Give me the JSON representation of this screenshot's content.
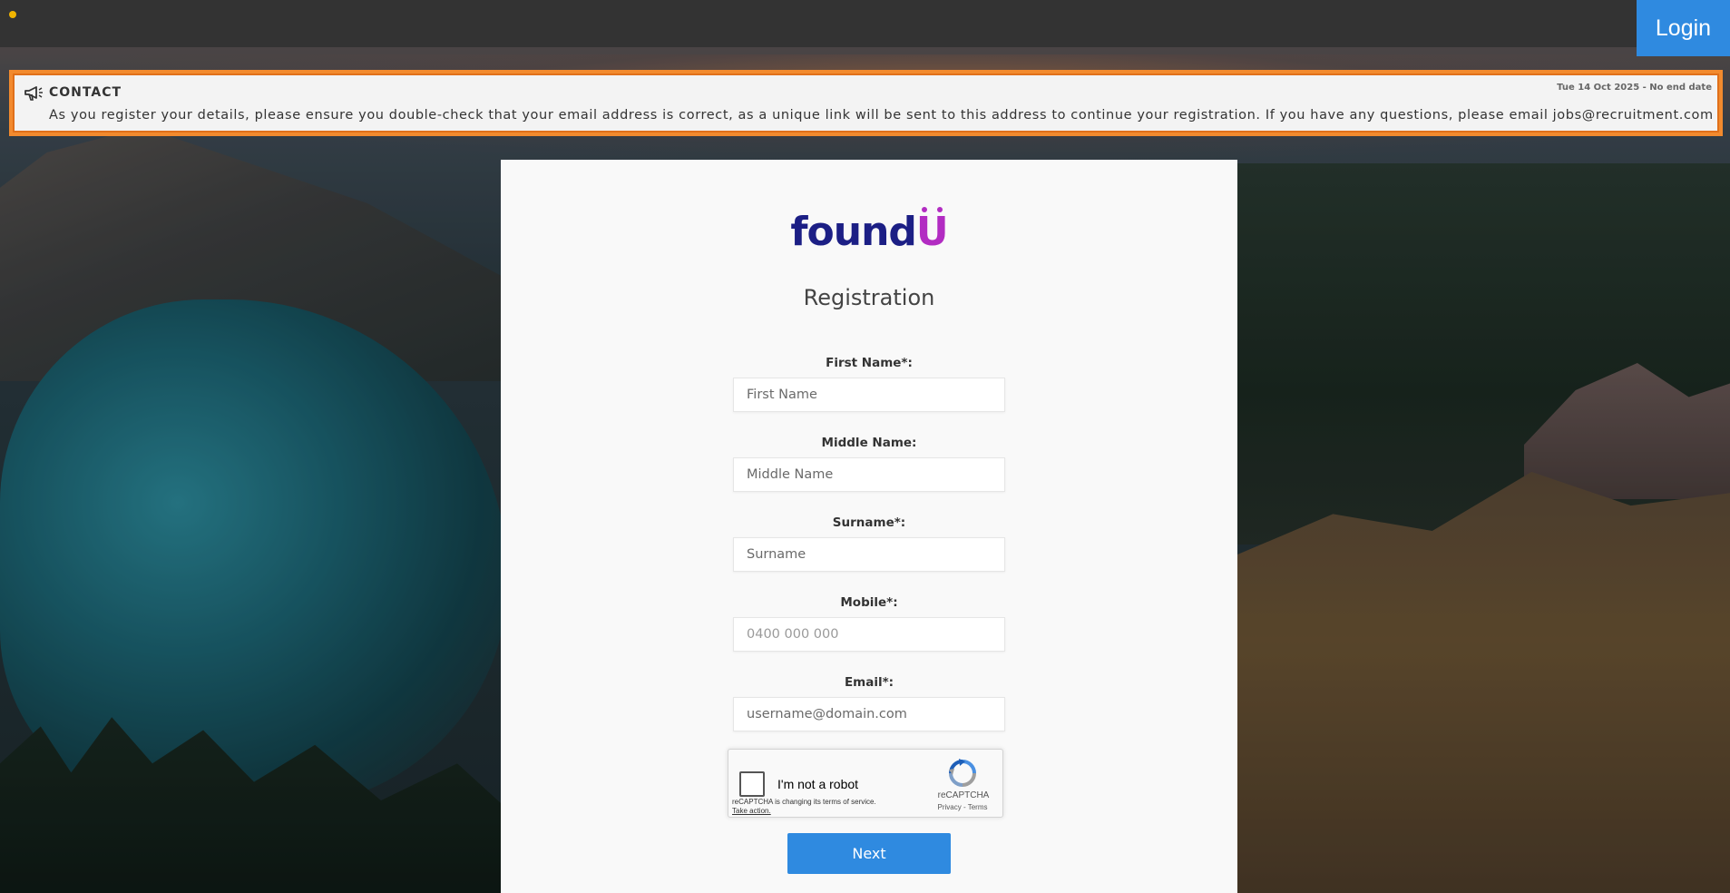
{
  "header": {
    "login_label": "Login"
  },
  "banner": {
    "icon": "megaphone-icon",
    "title": "CONTACT",
    "date": "Tue 14 Oct 2025 - No end date",
    "message": "As you register your details, please ensure you double-check that your email address is correct, as a unique link will be sent to this address to continue your registration. If you have any questions, please email jobs@recruitment.com",
    "border_color": "#f28a2e"
  },
  "form": {
    "logo_prefix": "found",
    "logo_suffix": "U",
    "title": "Registration",
    "fields": [
      {
        "label": "First Name*:",
        "placeholder": "First Name",
        "value": ""
      },
      {
        "label": "Middle Name:",
        "placeholder": "Middle Name",
        "value": ""
      },
      {
        "label": "Surname*:",
        "placeholder": "Surname",
        "value": ""
      },
      {
        "label": "Mobile*:",
        "placeholder": "0400 000 000",
        "value": ""
      },
      {
        "label": "Email*:",
        "placeholder": "username@domain.com",
        "value": ""
      }
    ],
    "recaptcha": {
      "checkbox_label": "I'm not a robot",
      "note_text": "reCAPTCHA is changing its terms of service.",
      "note_link": "Take action.",
      "brand": "reCAPTCHA",
      "links": "Privacy - Terms"
    },
    "next_label": "Next"
  },
  "colors": {
    "accent": "#2f8ae0",
    "topbar": "#333333",
    "logo_primary": "#1c1f85",
    "logo_accent": "#b22cc2"
  }
}
